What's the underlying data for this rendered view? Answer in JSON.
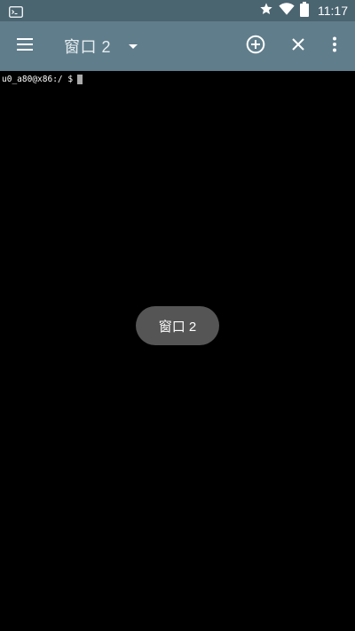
{
  "status_bar": {
    "time": "11:17",
    "icons": [
      "terminal-notification-icon",
      "star-icon",
      "wifi-icon",
      "battery-icon"
    ]
  },
  "toolbar": {
    "title": "窗口 2",
    "icons": [
      "menu-icon",
      "dropdown-arrow-icon",
      "add-circle-icon",
      "close-icon",
      "more-vert-icon"
    ]
  },
  "terminal": {
    "prompt": "u0_a80@x86:/ $"
  },
  "toast": {
    "text": "窗口 2"
  },
  "colors": {
    "status_bar": "#4a6470",
    "toolbar": "#607d8b",
    "terminal_bg": "#000000",
    "toast_bg": "#555555"
  }
}
